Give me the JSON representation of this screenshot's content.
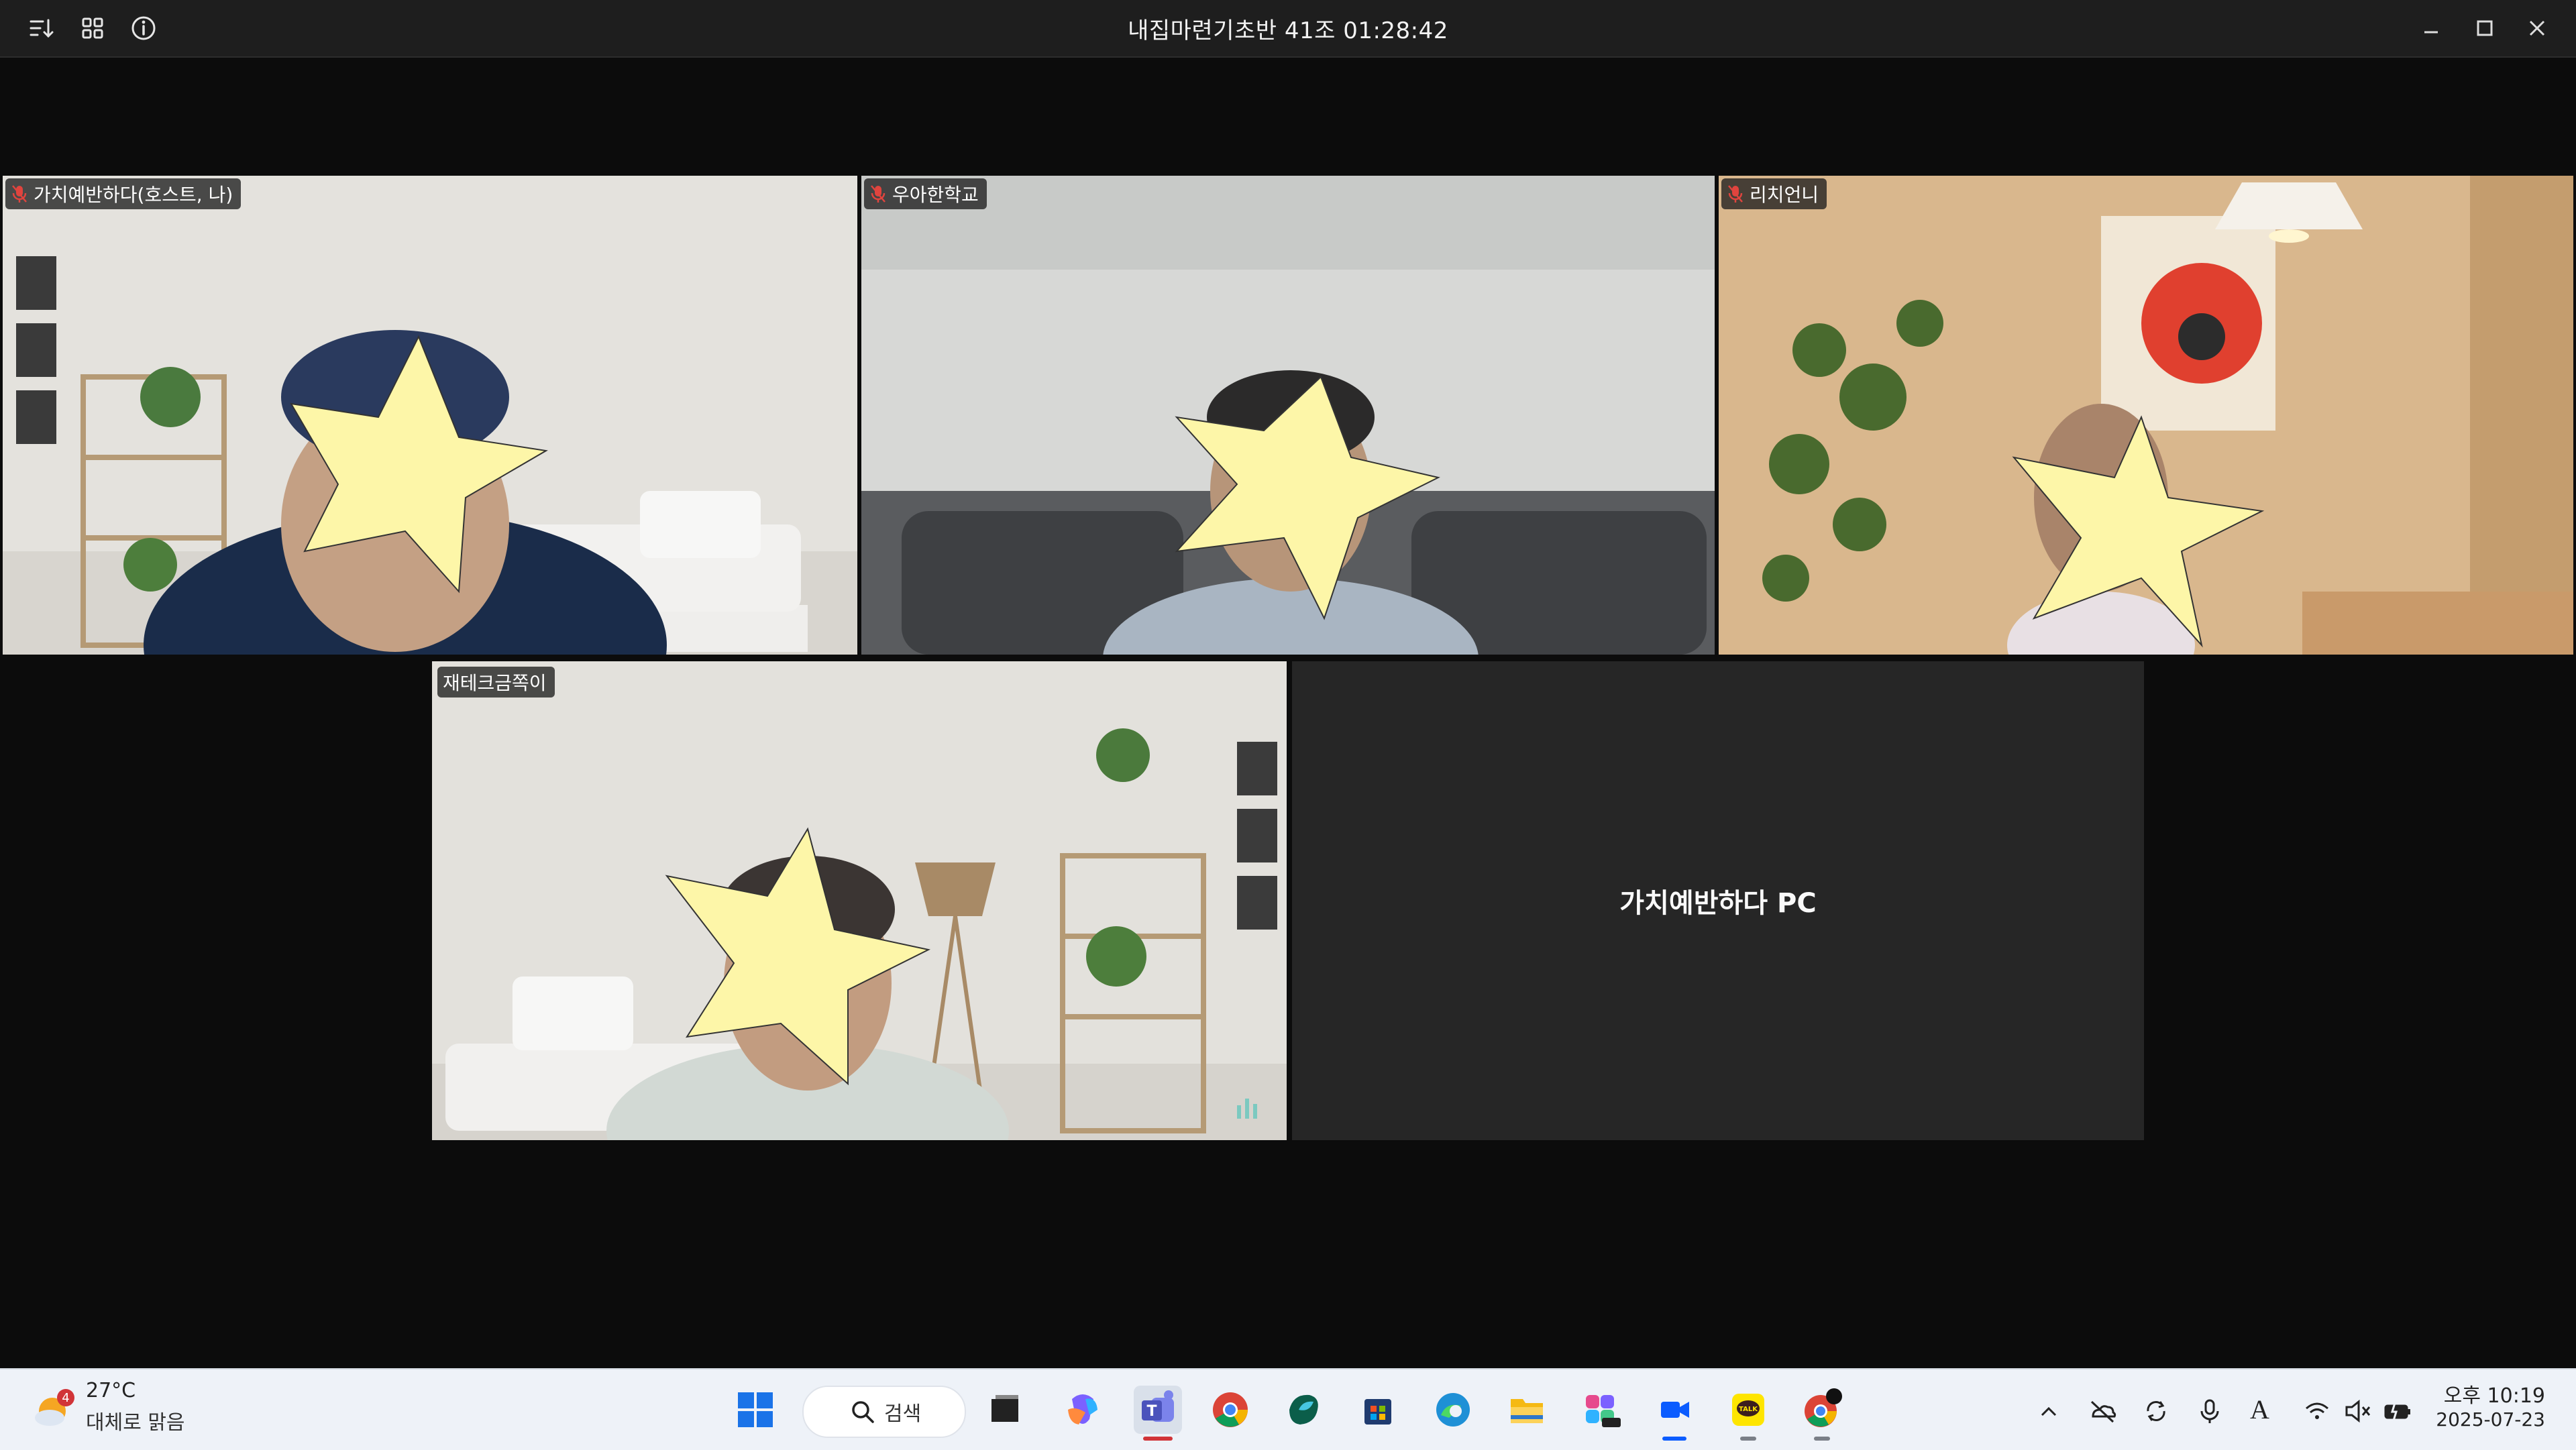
{
  "window": {
    "title": "내집마련기초반 41조 01:28:42",
    "toolbar_icons": [
      "sort-icon",
      "grid-view-icon",
      "info-icon"
    ],
    "controls": [
      "minimize-icon",
      "maximize-icon",
      "close-icon"
    ]
  },
  "participants": [
    {
      "name": "가치예반하다(호스트, 나)",
      "muted": true
    },
    {
      "name": "우아한학교",
      "muted": true
    },
    {
      "name": "리치언니",
      "muted": true
    },
    {
      "name": "재테크금쪽이",
      "muted": false,
      "speaking": true
    }
  ],
  "pc_tile": {
    "label": "가치예반하다 PC"
  },
  "taskbar": {
    "weather": {
      "temp": "27°C",
      "desc": "대체로 맑음",
      "badge": "4"
    },
    "search_label": "검색",
    "apps": [
      "start-icon",
      "search-icon",
      "task-view-icon",
      "copilot-icon",
      "teams-icon",
      "chrome-icon",
      "app-icon",
      "store-icon",
      "edge-icon",
      "file-explorer-icon",
      "m365-icon",
      "zoom-icon",
      "kakaotalk-icon",
      "chrome-profile-icon"
    ],
    "tray": [
      "chevron-up-icon",
      "onedrive-icon",
      "sync-icon",
      "microphone-icon",
      "ime-icon",
      "wifi-icon",
      "speaker-mute-icon",
      "battery-icon"
    ],
    "ime_label": "A",
    "time": "오후 10:19",
    "date": "2025-07-23"
  },
  "colors": {
    "speaking_border": "#22c55e",
    "mute_red": "#e0443e",
    "star": "#fdf6a8"
  }
}
